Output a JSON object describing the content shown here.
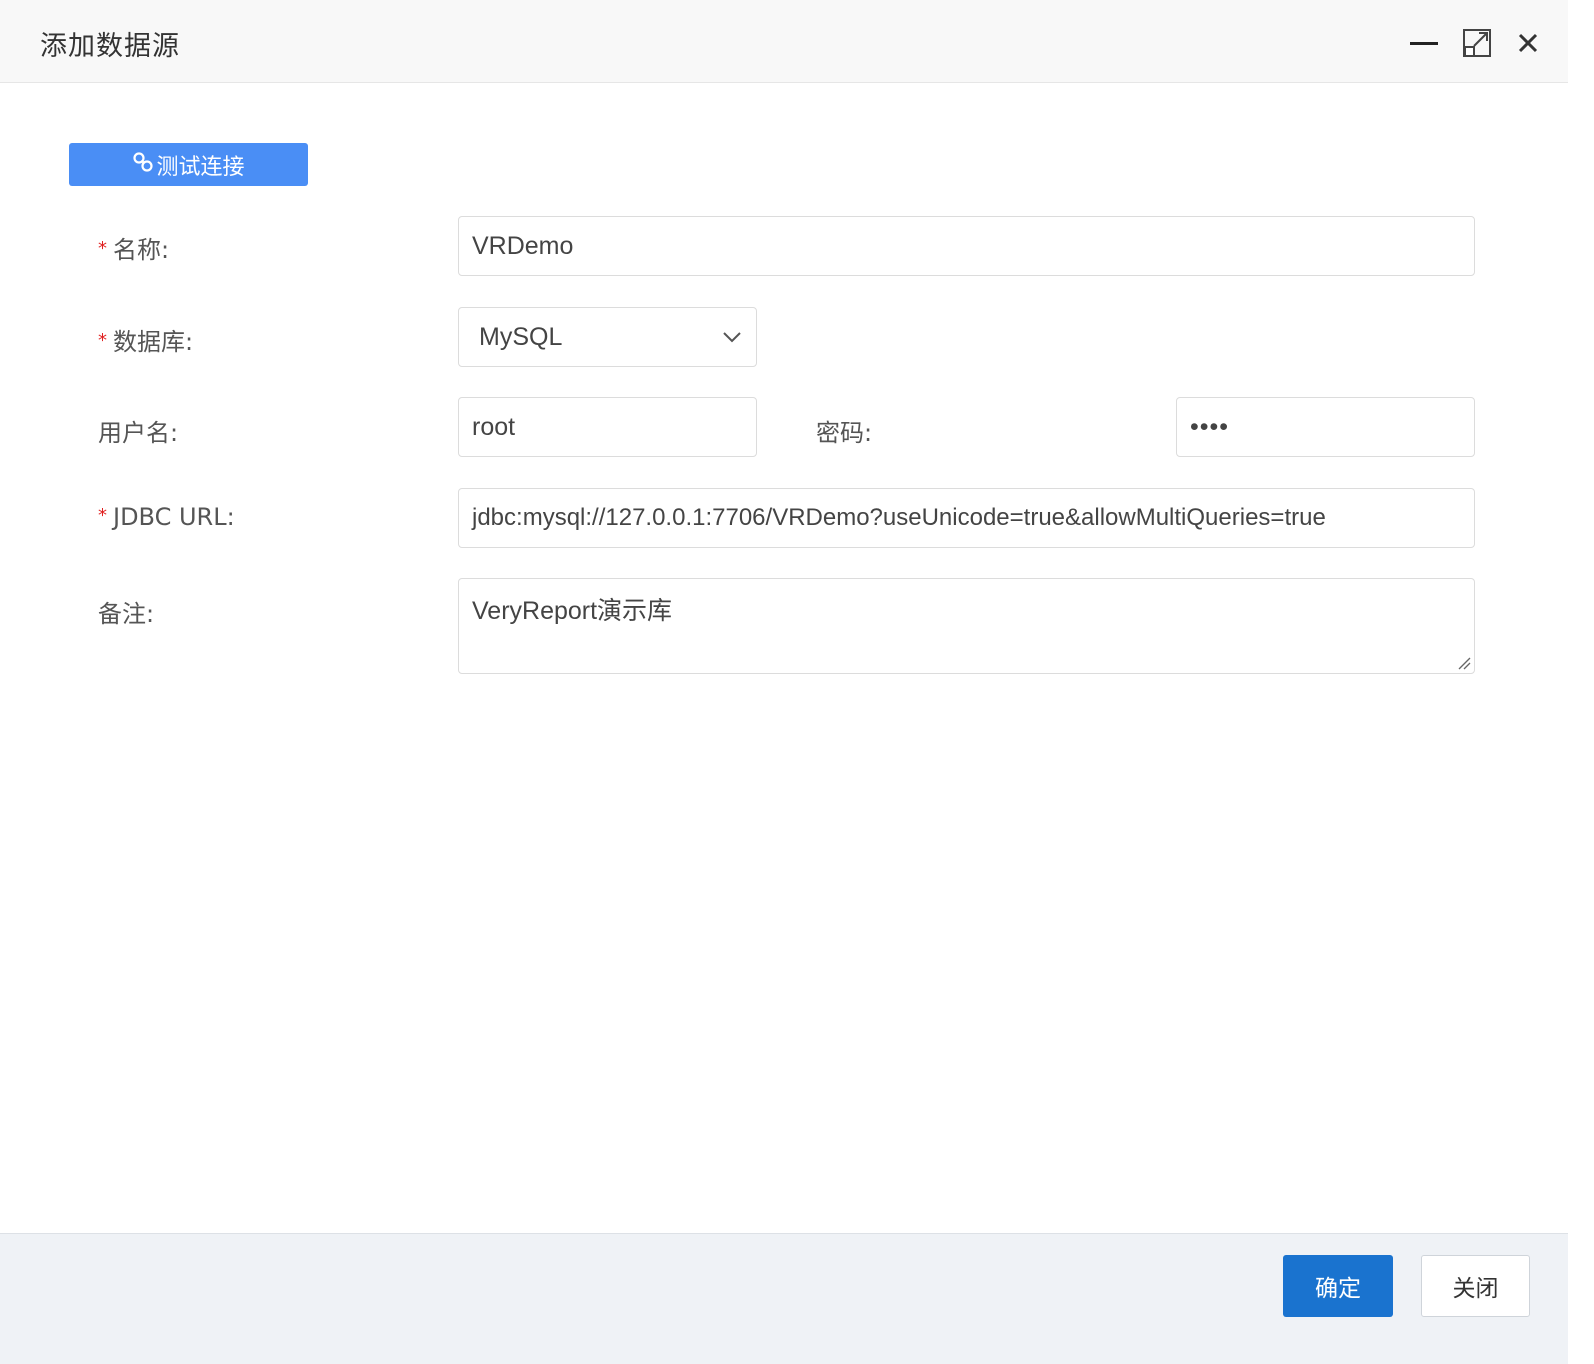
{
  "window": {
    "title": "添加数据源",
    "controls": {
      "minimize_icon": "minimize-icon",
      "maximize_icon": "maximize-icon",
      "close_icon": "close-icon"
    }
  },
  "toolbar": {
    "test_connection_label": "测试连接",
    "test_connection_icon": "link-icon"
  },
  "form": {
    "name": {
      "label": "名称:",
      "required": true,
      "value": "VRDemo"
    },
    "database": {
      "label": "数据库:",
      "required": true,
      "value": "MySQL"
    },
    "username": {
      "label": "用户名:",
      "value": "root"
    },
    "password": {
      "label": "密码:",
      "value": "••••"
    },
    "jdbc_url": {
      "label": "JDBC URL:",
      "required": true,
      "value": "jdbc:mysql://127.0.0.1:7706/VRDemo?useUnicode=true&allowMultiQueries=true"
    },
    "remark": {
      "label": "备注:",
      "value": "VeryReport演示库"
    },
    "required_mark": "*"
  },
  "footer": {
    "ok_label": "确定",
    "close_label": "关闭"
  },
  "colors": {
    "primary": "#1a73cf",
    "test_button": "#4a8ef5",
    "required": "#e02020"
  }
}
